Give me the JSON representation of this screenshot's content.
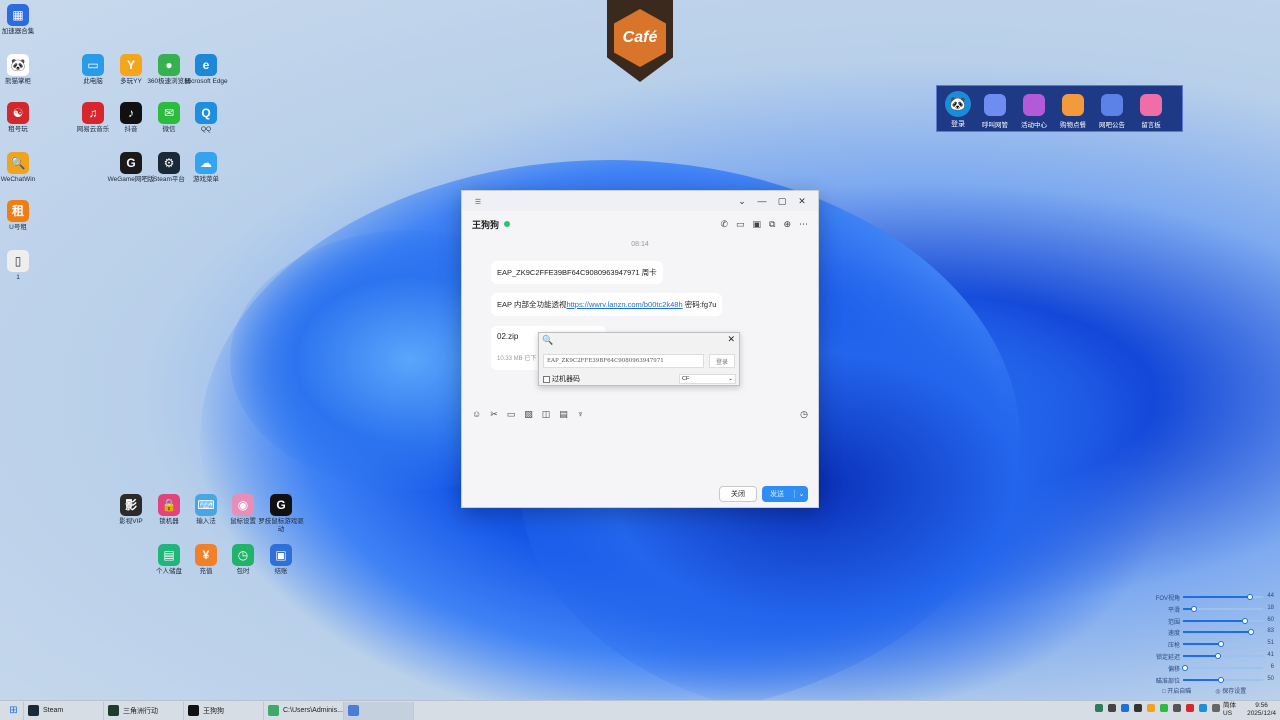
{
  "desktop": {
    "col1": [
      {
        "label": "加速器合集",
        "color": "#2b6de0",
        "glyph": "▦"
      },
      {
        "label": "熊猫掌柜",
        "color": "#ffffff",
        "glyph": "🐼"
      },
      {
        "label": "租号玩",
        "color": "#d2272d",
        "glyph": "☯"
      },
      {
        "label": "WeChatWin",
        "color": "#f0a31c",
        "glyph": "🔍"
      },
      {
        "label": "U号租",
        "color": "#f07d14",
        "glyph": "租"
      },
      {
        "label": "1",
        "color": "#eeeeee",
        "glyph": "▯"
      }
    ],
    "grid": [
      {
        "label": "此电脑",
        "color": "#2a9be8",
        "glyph": "▭"
      },
      {
        "label": "多玩YY",
        "color": "#f4a51c",
        "glyph": "Y"
      },
      {
        "label": "360极速浏览器",
        "color": "#36b14f",
        "glyph": "●"
      },
      {
        "label": "Microsoft Edge",
        "color": "#1e88d8",
        "glyph": "e"
      },
      {
        "label": "网易云音乐",
        "color": "#d7262e",
        "glyph": "♫"
      },
      {
        "label": "抖音",
        "color": "#111111",
        "glyph": "♪"
      },
      {
        "label": "微信",
        "color": "#2bbb3d",
        "glyph": "✉"
      },
      {
        "label": "QQ",
        "color": "#1e8fe0",
        "glyph": "Q"
      },
      {
        "label": "WeGame网吧版",
        "color": "#1a1a1a",
        "glyph": "G"
      },
      {
        "label": "Steam平台",
        "color": "#1b2838",
        "glyph": "⚙"
      },
      {
        "label": "游戏菜单",
        "color": "#35a4ef",
        "glyph": "☁"
      }
    ],
    "bottom": [
      {
        "label": "影视VIP",
        "color": "#2b2b2b",
        "glyph": "影"
      },
      {
        "label": "锁机器",
        "color": "#e3437d",
        "glyph": "🔒"
      },
      {
        "label": "输入法",
        "color": "#4aa6e0",
        "glyph": "⌨"
      },
      {
        "label": "鼠标设置",
        "color": "#e78fb9",
        "glyph": "◉"
      },
      {
        "label": "罗技鼠标游戏驱动",
        "color": "#111111",
        "glyph": "G"
      },
      {
        "label": "个人储盘",
        "color": "#1fb57b",
        "glyph": "▤"
      },
      {
        "label": "充值",
        "color": "#f0812a",
        "glyph": "¥"
      },
      {
        "label": "包时",
        "color": "#22b36a",
        "glyph": "◷"
      },
      {
        "label": "结账",
        "color": "#2e6fd8",
        "glyph": "▣"
      }
    ]
  },
  "cafe": {
    "label": "Café"
  },
  "toolbar": {
    "login": "登录",
    "items": [
      {
        "label": "呼叫网管",
        "color": "#6f8cf0"
      },
      {
        "label": "活动中心",
        "color": "#b35ad8"
      },
      {
        "label": "购物点餐",
        "color": "#f39a3c"
      },
      {
        "label": "网吧公告",
        "color": "#5c82e8"
      },
      {
        "label": "留言板",
        "color": "#ef6ea8"
      }
    ]
  },
  "chat": {
    "title_controls": [
      "⌄",
      "—",
      "▢",
      "✕"
    ],
    "contact": "王狗狗",
    "time": "08:14",
    "msg1": "EAP_ZK9C2FFE39BF64C9080963947971   周卡",
    "msg2_prefix": "EAP 内部全功能透视",
    "msg2_link": "https://wwrv.lanzn.com/b00tc2k48h",
    "msg2_suffix": "  密码:fg7u",
    "file_name": "02.zip",
    "file_size": "10.33 MB   已下",
    "close_btn": "关闭",
    "send_btn": "发送"
  },
  "popup": {
    "key": "EAP_ZK9C2FFE39BF64C9080963947971",
    "login_btn": "登录",
    "checkbox": "过机器码",
    "select": "CF"
  },
  "sliders": [
    {
      "label": "FOV视角",
      "value": "44",
      "level": 0.84
    },
    {
      "label": "平滑",
      "value": "18",
      "level": 0.14
    },
    {
      "label": "范围",
      "value": "60",
      "level": 0.78
    },
    {
      "label": "速度",
      "value": "83",
      "level": 0.85
    },
    {
      "label": "压枪",
      "value": "51",
      "level": 0.48
    },
    {
      "label": "锁定延迟",
      "value": "41",
      "level": 0.44
    },
    {
      "label": "偏移",
      "value": "6",
      "level": 0.03
    },
    {
      "label": "瞄准部位",
      "value": "50",
      "level": 0.47
    }
  ],
  "slider_foot": [
    "□ 开启自瞄",
    "◎ 保存设置"
  ],
  "taskbar": {
    "items": [
      {
        "label": "Steam",
        "color": "#1b2838"
      },
      {
        "label": "三角洲行动",
        "color": "#1f3b2c"
      },
      {
        "label": "王狗狗",
        "color": "#111111"
      },
      {
        "label": "C:\\Users\\Adminis...",
        "color": "#3fa86b"
      },
      {
        "label": "",
        "color": "#4d7bd8"
      }
    ],
    "lang1": "简体",
    "lang2": "US",
    "time": "9:56",
    "date": "2025/12/4"
  }
}
